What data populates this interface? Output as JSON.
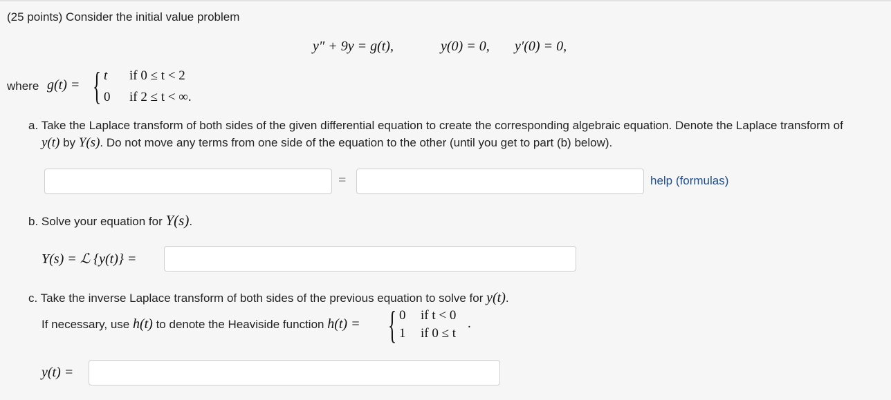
{
  "problem": {
    "intro": "(25 points) Consider the initial value problem",
    "ivp": {
      "ode_y2": "y″",
      "ode_rest": " + 9y = g(t),",
      "ic1": "y(0) = 0,",
      "ic2": "y′(0) = 0,"
    },
    "g_def": {
      "where": "where",
      "lhs": "g(t) =",
      "case1_val": "t",
      "case1_cond": "if 0 ≤ t < 2",
      "case2_val": "0",
      "case2_cond": "if 2 ≤ t < ∞."
    }
  },
  "part_a": {
    "prefix": "a. Take the Laplace transform of both sides of the given differential equation to create the corresponding algebraic equation. Denote the Laplace transform of",
    "line2_y": "y(t)",
    "line2_by": " by ",
    "line2_Y": "Y(s)",
    "line2_rest": ". Do not move any terms from one side of the equation to the other (until you get to part (b) below).",
    "equals": "=",
    "help_link": "help (formulas)",
    "left_value": "",
    "right_value": ""
  },
  "part_b": {
    "label_pre": "b. Solve your equation for ",
    "label_Y": "Y(s)",
    "label_post": ".",
    "lhs": "Y(s) = ℒ {y(t)} =",
    "value": ""
  },
  "part_c": {
    "label_pre": "c. Take the inverse Laplace transform of both sides of the previous equation to solve for ",
    "label_y": "y(t)",
    "label_post": ".",
    "heaviside_pre": "If necessary, use ",
    "heaviside_h": "h(t)",
    "heaviside_mid": " to denote the Heaviside function ",
    "heaviside_lhs": "h(t) =",
    "h_case1_val": "0",
    "h_case1_cond": "if t < 0",
    "h_case2_val": "1",
    "h_case2_cond": "if 0 ≤ t",
    "trailing_dot": ".",
    "lhs": "y(t) =",
    "value": ""
  }
}
